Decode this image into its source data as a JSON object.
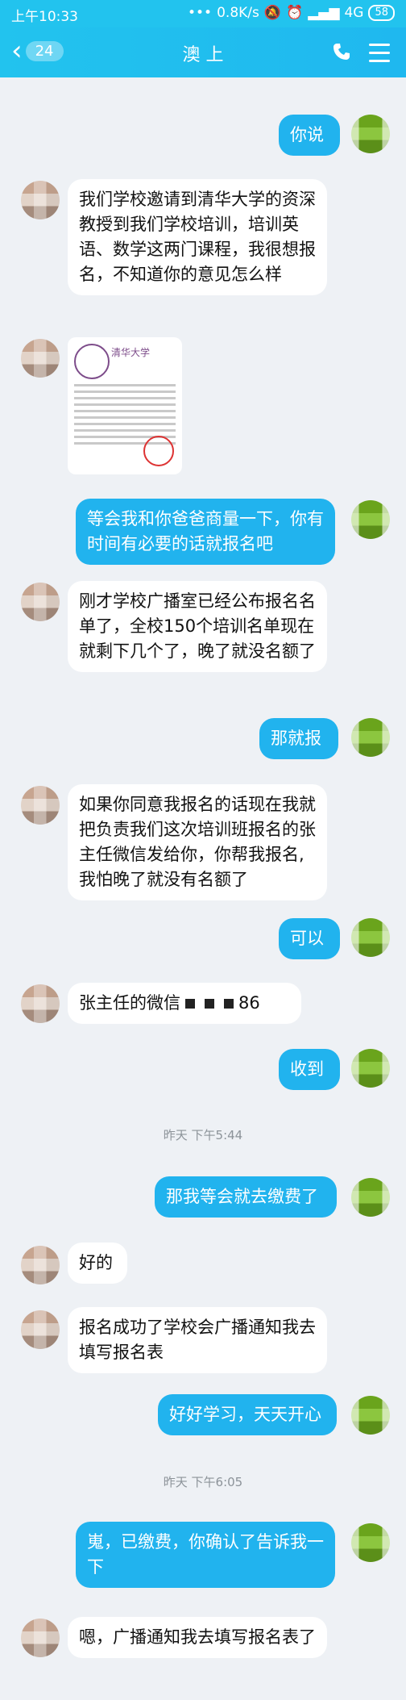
{
  "statusbar": {
    "time": "上午10:33",
    "net": "0.8K/s",
    "signal": "4G",
    "battery": "58"
  },
  "navbar": {
    "unread_count": "24",
    "title": "澳 上",
    "icons": [
      "back-icon",
      "phone-icon",
      "menu-icon"
    ]
  },
  "messages": [
    {
      "side": "right",
      "text": "你说"
    },
    {
      "side": "left",
      "text": "我们学校邀请到清华大学的资深教授到我们学校培训，培训英语、数学这两门课程，我很想报名，不知道你的意见怎么样"
    },
    {
      "side": "left",
      "type": "image",
      "text": "清华大学"
    },
    {
      "side": "right",
      "text": "等会我和你爸爸商量一下，你有时间有必要的话就报名吧"
    },
    {
      "side": "left",
      "text": "刚才学校广播室已经公布报名名单了，全校150个培训名单现在就剩下几个了，晚了就没名额了"
    },
    {
      "side": "right",
      "text": "那就报"
    },
    {
      "side": "left",
      "text": "如果你同意我报名的话现在我就把负责我们这次培训班报名的张主任微信发给你，你帮我报名,我怕晚了就没有名额了"
    },
    {
      "side": "right",
      "text": "可以"
    },
    {
      "side": "left",
      "text_a": "张主任的微信",
      "text_b": "86"
    },
    {
      "side": "right",
      "text": "收到"
    },
    {
      "type": "time",
      "text": "昨天 下午5:44"
    },
    {
      "side": "right",
      "text": "那我等会就去缴费了"
    },
    {
      "side": "left",
      "text": "好的"
    },
    {
      "side": "left",
      "text": "报名成功了学校会广播通知我去填写报名表"
    },
    {
      "side": "right",
      "text": "好好学习，天天开心"
    },
    {
      "type": "time",
      "text": "昨天 下午6:05"
    },
    {
      "side": "right",
      "text": "嵬，已缴费，你确认了告诉我一下"
    },
    {
      "side": "left",
      "text": "嗯，广播通知我去填写报名表了"
    }
  ]
}
